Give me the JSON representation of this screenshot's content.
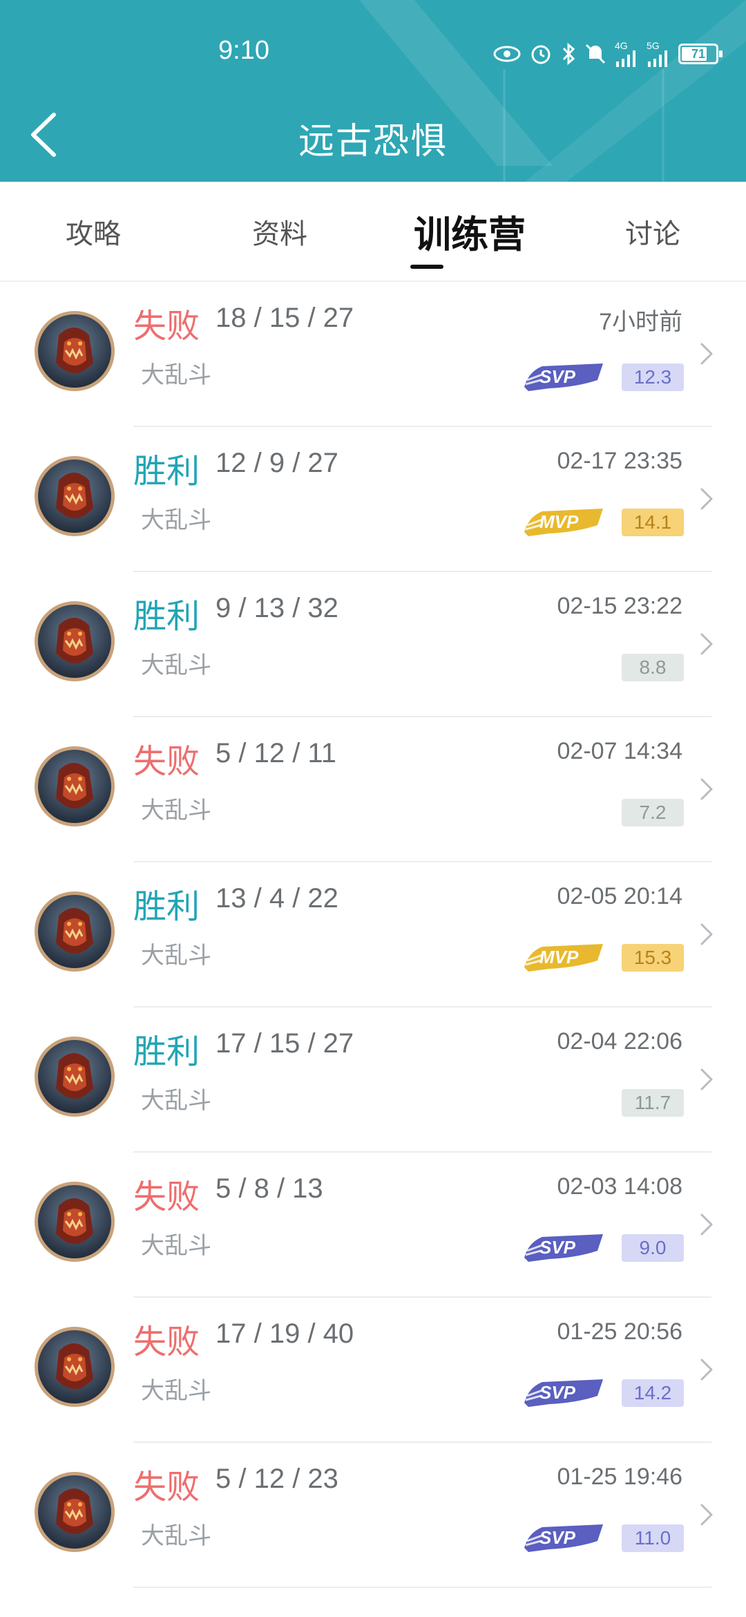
{
  "status_bar": {
    "time": "9:10",
    "battery": "71",
    "net1": "4G",
    "net2": "5G"
  },
  "header": {
    "title": "远古恐惧"
  },
  "tabs": [
    {
      "label": "攻略",
      "active": false
    },
    {
      "label": "资料",
      "active": false
    },
    {
      "label": "训练营",
      "active": true
    },
    {
      "label": "讨论",
      "active": false
    }
  ],
  "matches": [
    {
      "result": "失败",
      "kda": "18 / 15 / 27",
      "mode": "大乱斗",
      "time": "7小时前",
      "badge": "SVP",
      "score": "12.3"
    },
    {
      "result": "胜利",
      "kda": "12 / 9 / 27",
      "mode": "大乱斗",
      "time": "02-17 23:35",
      "badge": "MVP",
      "score": "14.1"
    },
    {
      "result": "胜利",
      "kda": "9 / 13 / 32",
      "mode": "大乱斗",
      "time": "02-15 23:22",
      "badge": "",
      "score": "8.8"
    },
    {
      "result": "失败",
      "kda": "5 / 12 / 11",
      "mode": "大乱斗",
      "time": "02-07 14:34",
      "badge": "",
      "score": "7.2"
    },
    {
      "result": "胜利",
      "kda": "13 / 4 / 22",
      "mode": "大乱斗",
      "time": "02-05 20:14",
      "badge": "MVP",
      "score": "15.3"
    },
    {
      "result": "胜利",
      "kda": "17 / 15 / 27",
      "mode": "大乱斗",
      "time": "02-04 22:06",
      "badge": "",
      "score": "11.7"
    },
    {
      "result": "失败",
      "kda": "5 / 8 / 13",
      "mode": "大乱斗",
      "time": "02-03 14:08",
      "badge": "SVP",
      "score": "9.0"
    },
    {
      "result": "失败",
      "kda": "17 / 19 / 40",
      "mode": "大乱斗",
      "time": "01-25 20:56",
      "badge": "SVP",
      "score": "14.2"
    },
    {
      "result": "失败",
      "kda": "5 / 12 / 23",
      "mode": "大乱斗",
      "time": "01-25 19:46",
      "badge": "SVP",
      "score": "11.0"
    }
  ],
  "colors": {
    "header": "#2fa6b4",
    "win": "#21a5b5",
    "lose": "#ee6e6e",
    "svp": "#5a5fc0",
    "mvp": "#e8b92e"
  }
}
